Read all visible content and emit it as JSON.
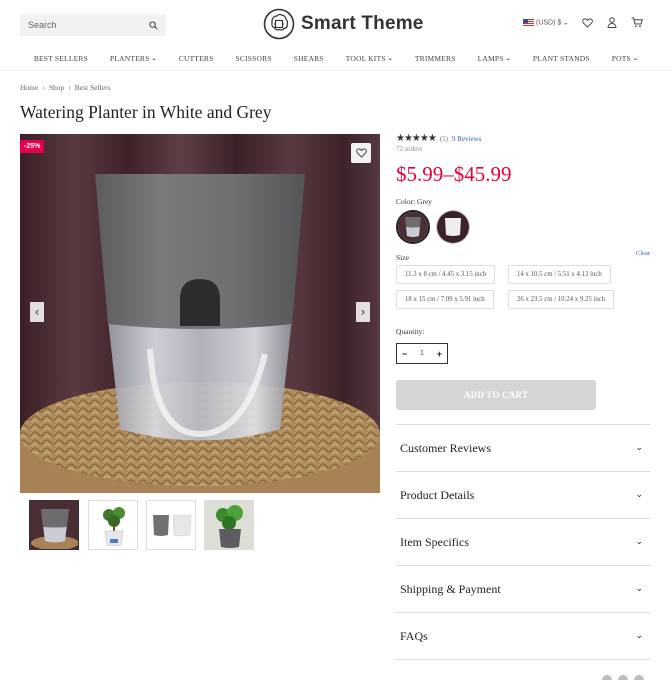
{
  "header": {
    "search_placeholder": "Search",
    "logo_text": "Smart Theme",
    "currency": "(USD) $"
  },
  "nav": {
    "items": [
      {
        "label": "BEST SELLERS",
        "dropdown": false
      },
      {
        "label": "PLANTERS",
        "dropdown": true
      },
      {
        "label": "CUTTERS",
        "dropdown": false
      },
      {
        "label": "SCISSORS",
        "dropdown": false
      },
      {
        "label": "SHEARS",
        "dropdown": false
      },
      {
        "label": "TOOL KITS",
        "dropdown": true
      },
      {
        "label": "TRIMMERS",
        "dropdown": false
      },
      {
        "label": "LAMPS",
        "dropdown": true
      },
      {
        "label": "PLANT STANDS",
        "dropdown": false
      },
      {
        "label": "POTS",
        "dropdown": true
      }
    ]
  },
  "breadcrumb": [
    "Home",
    "Shop",
    "Best Sellers"
  ],
  "breadcrumb_sep": "›",
  "product": {
    "title": "Watering Planter in White and Grey",
    "discount_badge": "-25%",
    "rating_count": "(5)",
    "reviews_link": "9 Reviews",
    "orders": "72 orders",
    "price": "$5.99–$45.99",
    "color_label": "Color: Grey",
    "size_label": "Size",
    "clear_label": "Clear",
    "sizes": [
      "11.3 x 8 cm / 4.45 x 3.15 inch",
      "14 x 10.5 cm / 5.51 x 4.13 inch",
      "18 x 15 cm / 7.09 x 5.91 inch",
      "26 x 23.5 cm / 10.24 x 9.25 inch"
    ],
    "quantity_label": "Quantity:",
    "quantity_value": "1",
    "add_to_cart": "ADD TO CART"
  },
  "accordion": [
    "Customer Reviews",
    "Product Details",
    "Item Specifics",
    "Shipping & Payment",
    "FAQs"
  ],
  "colors": {
    "accent": "#e8003d",
    "badge": "#e5004f",
    "link": "#3a5fb0"
  }
}
